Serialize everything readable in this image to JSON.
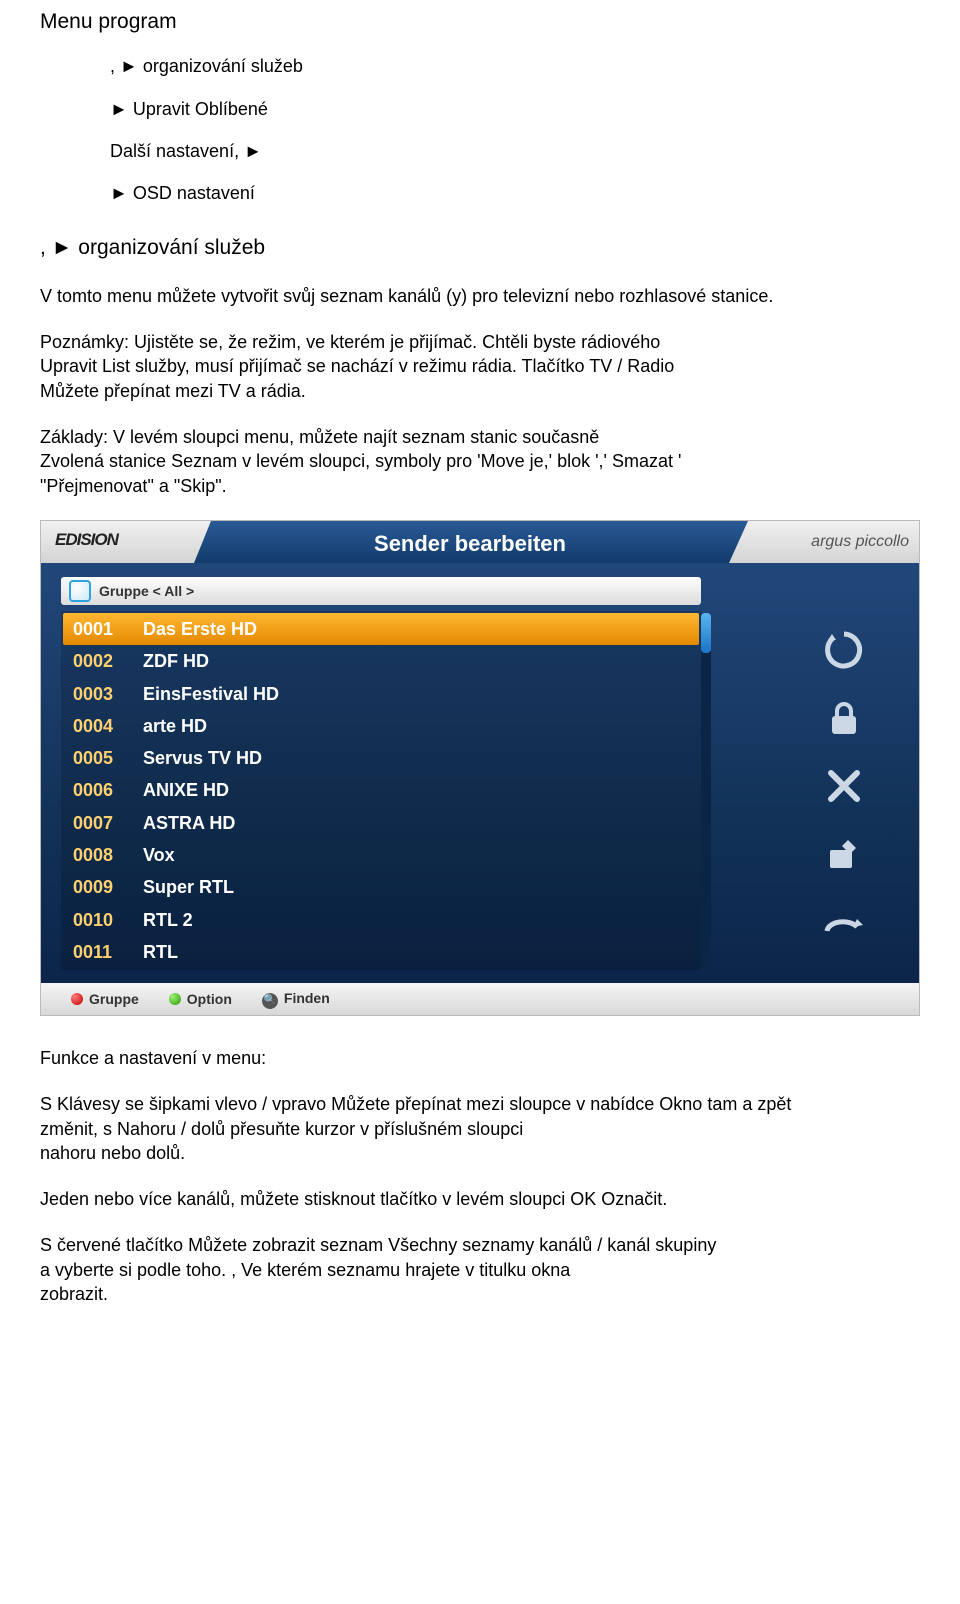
{
  "doc": {
    "title": "Menu program",
    "line1": ", ► organizování služeb",
    "line2": "► Upravit Oblíbené",
    "line3": "Další nastavení, ►",
    "line4": "► OSD nastavení",
    "line5": ", ► organizování služeb",
    "p1a": "V tomto menu můžete vytvořit svůj seznam kanálů (y) pro televizní nebo rozhlasové stanice.",
    "p2a": "Poznámky: Ujistěte se, že režim, ve kterém je přijímač. Chtěli byste rádiového",
    "p2b": "Upravit List služby, musí přijímač se nachází v režimu rádia. Tlačítko TV / Radio",
    "p2c": "Můžete přepínat mezi TV a rádia.",
    "p3a": "Základy: V levém sloupci menu, můžete najít seznam stanic současně",
    "p3b": "Zvolená stanice Seznam v levém sloupci, symboly pro 'Move je,' blok ',' Smazat '",
    "p3c": "\"Přejmenovat\" a \"Skip\".",
    "p4": "Funkce a nastavení v menu:",
    "p5a": "S Klávesy se šipkami vlevo / vpravo Můžete přepínat mezi sloupce v nabídce Okno tam a zpět",
    "p5b": "změnit, s Nahoru / dolů přesuňte kurzor v příslušném sloupci",
    "p5c": "nahoru nebo dolů.",
    "p6": "Jeden nebo více kanálů, můžete stisknout tlačítko v levém sloupci OK Označit.",
    "p7a": "S červené tlačítko Můžete zobrazit seznam Všechny seznamy kanálů / kanál skupiny",
    "p7b": "a vyberte si podle toho. , Ve kterém seznamu hrajete v titulku okna",
    "p7c": "zobrazit."
  },
  "device": {
    "brand": "EDISION",
    "title": "Sender bearbeiten",
    "model": "argus piccollo",
    "group_label": "Gruppe < All >",
    "channels": [
      {
        "num": "0001",
        "name": "Das Erste HD",
        "selected": true
      },
      {
        "num": "0002",
        "name": "ZDF HD",
        "selected": false
      },
      {
        "num": "0003",
        "name": "EinsFestival HD",
        "selected": false
      },
      {
        "num": "0004",
        "name": "arte HD",
        "selected": false
      },
      {
        "num": "0005",
        "name": "Servus TV HD",
        "selected": false
      },
      {
        "num": "0006",
        "name": "ANIXE HD",
        "selected": false
      },
      {
        "num": "0007",
        "name": "ASTRA HD",
        "selected": false
      },
      {
        "num": "0008",
        "name": "Vox",
        "selected": false
      },
      {
        "num": "0009",
        "name": "Super RTL",
        "selected": false
      },
      {
        "num": "0010",
        "name": "RTL 2",
        "selected": false
      },
      {
        "num": "0011",
        "name": "RTL",
        "selected": false
      }
    ],
    "side_icons": [
      "move-icon",
      "lock-icon",
      "delete-icon",
      "rename-icon",
      "skip-icon"
    ],
    "footer": {
      "red": "Gruppe",
      "green": "Option",
      "search": "Finden"
    }
  }
}
